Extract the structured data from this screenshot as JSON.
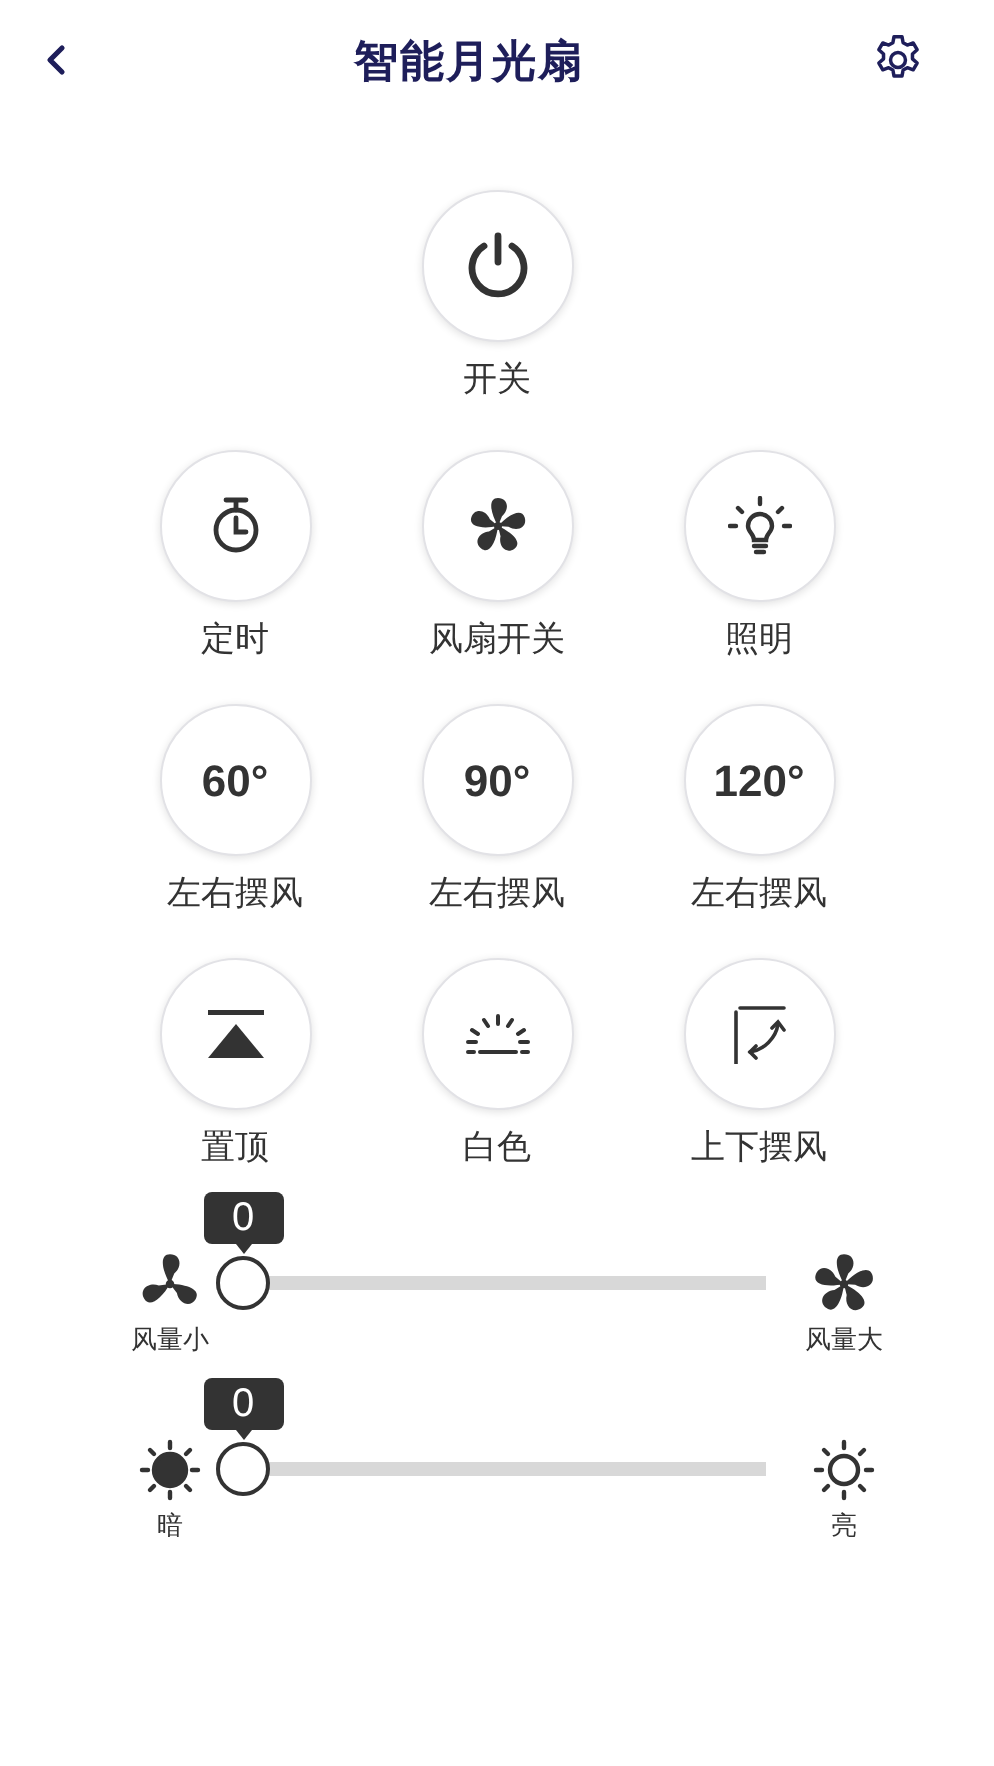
{
  "header": {
    "title": "智能月光扇"
  },
  "power": {
    "label": "开关"
  },
  "controls": [
    {
      "kind": "icon",
      "label": "定时"
    },
    {
      "kind": "icon",
      "label": "风扇开关"
    },
    {
      "kind": "icon",
      "label": "照明"
    },
    {
      "kind": "text",
      "value": "60°",
      "label": "左右摆风"
    },
    {
      "kind": "text",
      "value": "90°",
      "label": "左右摆风"
    },
    {
      "kind": "text",
      "value": "120°",
      "label": "左右摆风"
    },
    {
      "kind": "icon",
      "label": "置顶"
    },
    {
      "kind": "icon",
      "label": "白色"
    },
    {
      "kind": "icon",
      "label": "上下摆风"
    }
  ],
  "sliders": [
    {
      "reading": "0",
      "level": 0,
      "min_label": "风量小",
      "max_label": "风量大"
    },
    {
      "reading": "0",
      "level": 0,
      "min_label": "暗",
      "max_label": "亮"
    }
  ]
}
